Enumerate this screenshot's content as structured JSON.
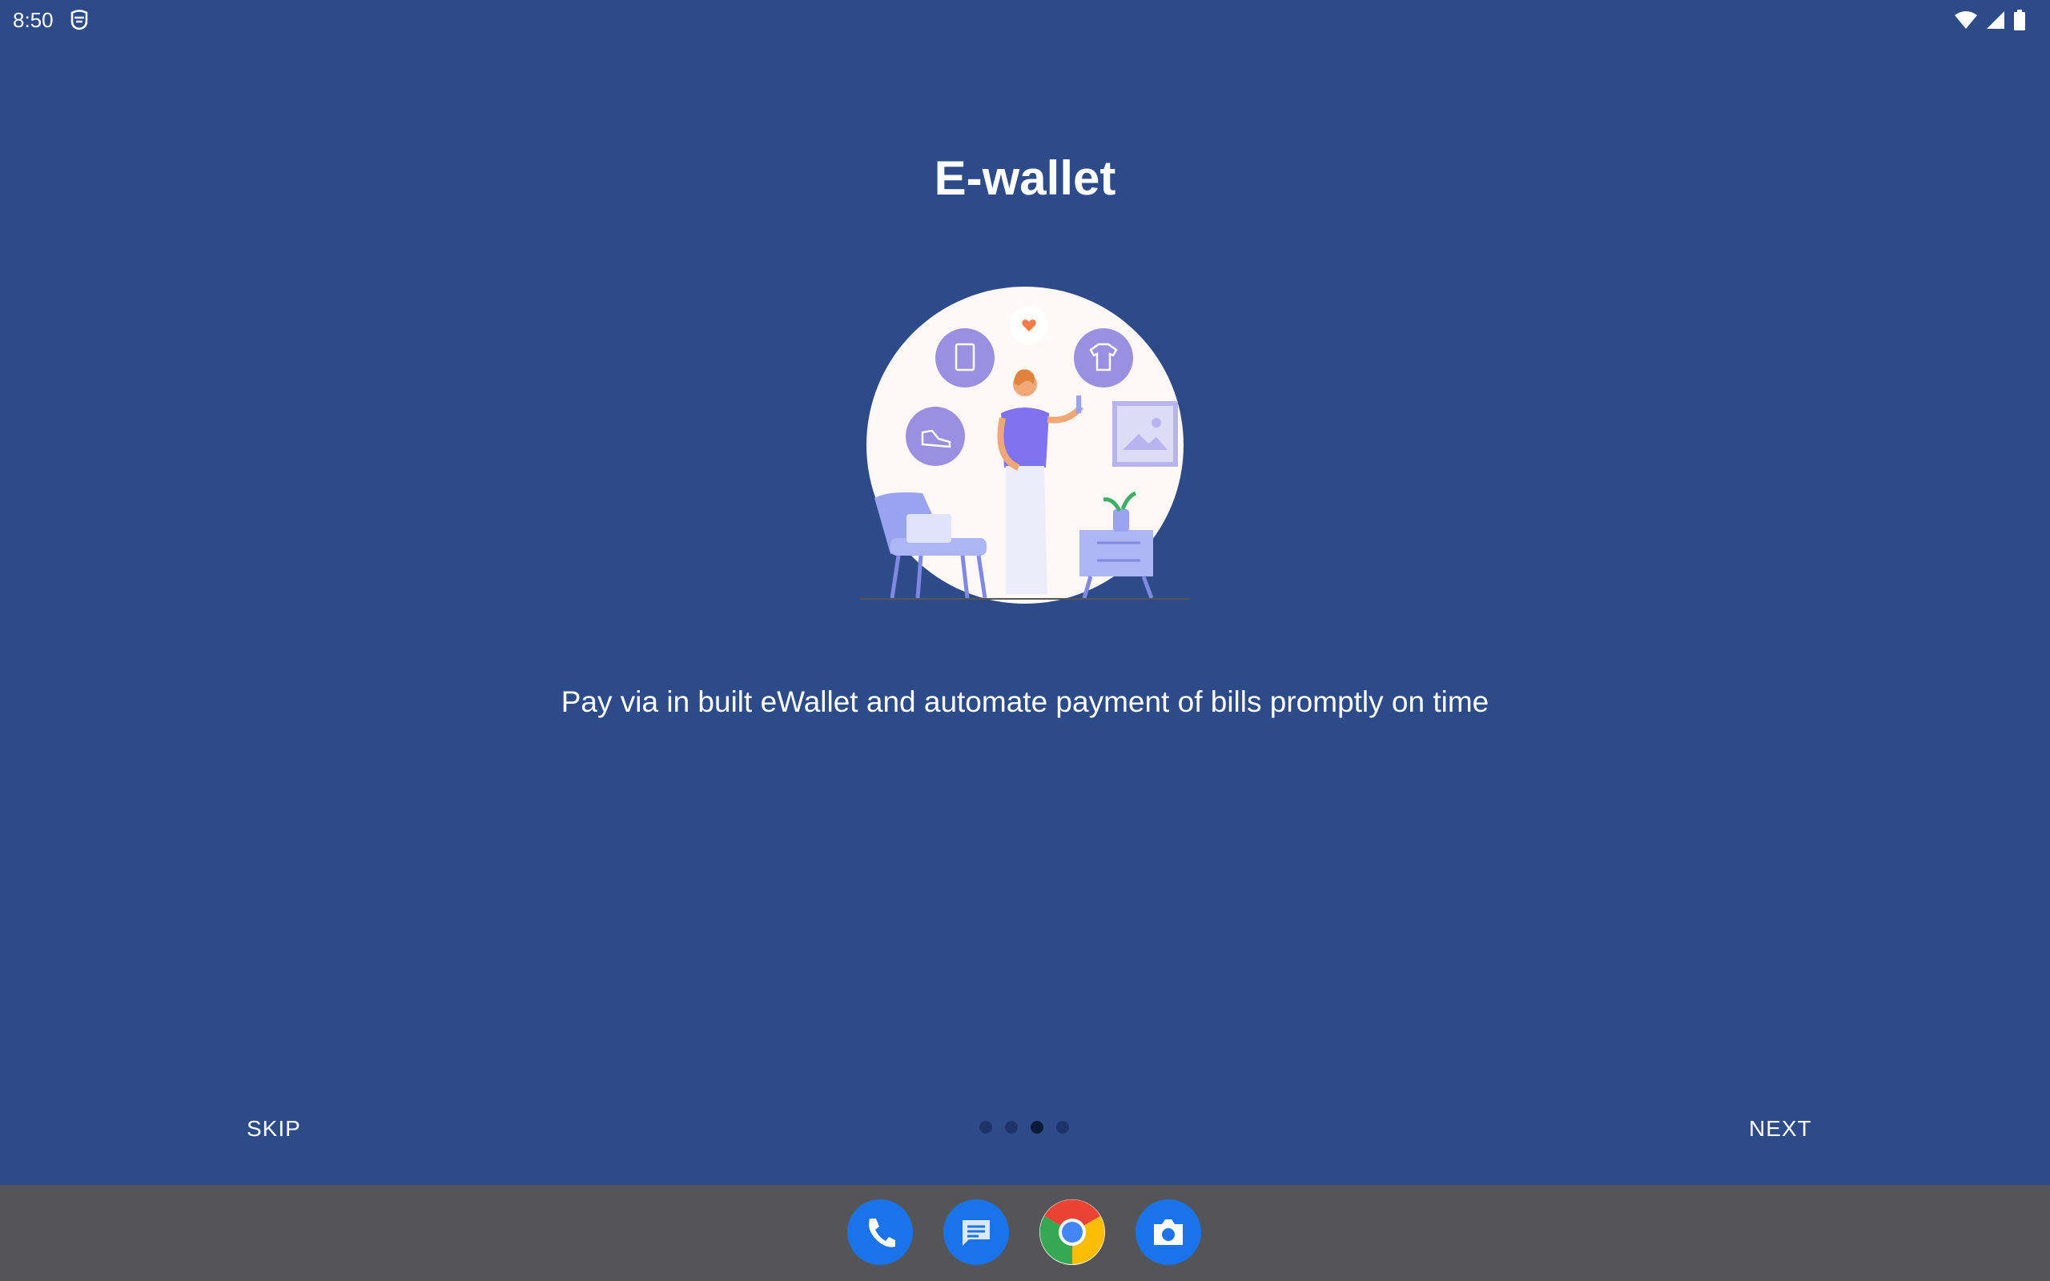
{
  "status_bar": {
    "time": "8:50",
    "icons": [
      "mask-icon",
      "wifi-icon",
      "cell-signal-icon",
      "battery-icon"
    ]
  },
  "onboarding": {
    "title": "E-wallet",
    "description": "Pay via in built eWallet and automate payment of bills promptly on time",
    "illustration": "woman-shopping-illustration",
    "skip_label": "SKIP",
    "next_label": "NEXT",
    "page_count": 4,
    "current_page": 3
  },
  "dock": {
    "apps": [
      "phone-app-icon",
      "messages-app-icon",
      "chrome-app-icon",
      "camera-app-icon"
    ]
  },
  "colors": {
    "background": "#2d4b89",
    "dot_inactive": "#1d3568",
    "dot_active": "#0c1a3a",
    "dock_background": "#555557",
    "app_blue": "#1a73e8"
  }
}
